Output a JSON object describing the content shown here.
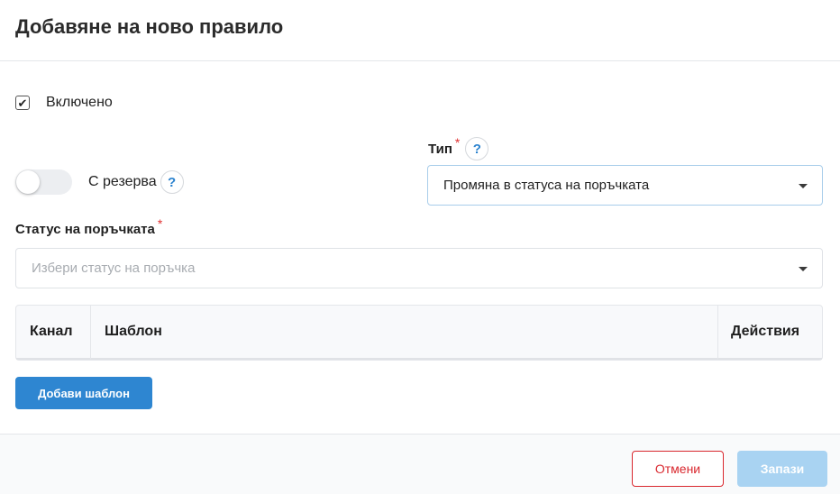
{
  "modal": {
    "title": "Добавяне на ново правило"
  },
  "enabled": {
    "label": "Включено",
    "checked": true,
    "check_glyph": "✔"
  },
  "reserve": {
    "label": "С резерва",
    "on": false,
    "help_glyph": "?"
  },
  "type_field": {
    "label": "Тип",
    "required_mark": "*",
    "help_glyph": "?",
    "value": "Промяна в статуса на поръчката"
  },
  "order_status_field": {
    "label": "Статус на поръчката",
    "required_mark": "*",
    "placeholder": "Избери статус на поръчка",
    "value": ""
  },
  "templates_table": {
    "columns": [
      "Канал",
      "Шаблон",
      "Действия"
    ],
    "rows": []
  },
  "add_template_button": {
    "label": "Добави шаблон"
  },
  "footer": {
    "cancel_label": "Отмени",
    "save_label": "Запази"
  },
  "colors": {
    "primary": "#2e86d1",
    "primary_disabled": "#a9d3f2",
    "danger": "#d9272e",
    "required": "#e03131",
    "help_icon": "#2c83cf"
  }
}
